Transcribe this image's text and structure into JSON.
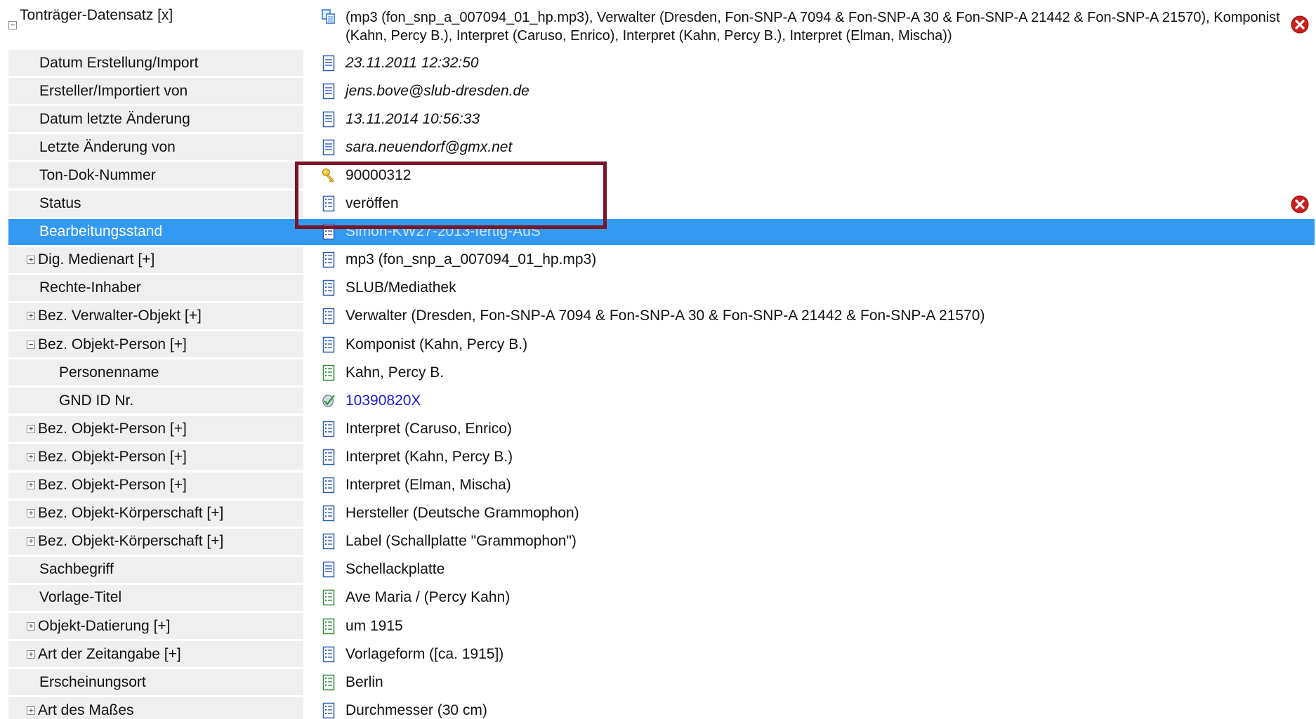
{
  "header": {
    "label": "Tonträger-Datensatz [x]",
    "value": "(mp3 (fon_snp_a_007094_01_hp.mp3), Verwalter (Dresden, Fon-SNP-A 7094 & Fon-SNP-A 30 & Fon-SNP-A 21442 & Fon-SNP-A 21570), Komponist (Kahn, Percy B.), Interpret (Caruso, Enrico), Interpret (Kahn, Percy B.), Interpret (Elman, Mischa))",
    "icon": "copy-records-icon",
    "expander": "−"
  },
  "rows": [
    {
      "label": "Datum Erstellung/Import",
      "value": "23.11.2011 12:32:50",
      "icon": "document-icon"
    },
    {
      "label": "Ersteller/Importiert von",
      "value": "jens.bove@slub-dresden.de",
      "icon": "document-icon"
    },
    {
      "label": "Datum letzte Änderung",
      "value": "13.11.2014 10:56:33",
      "icon": "document-icon"
    },
    {
      "label": "Letzte Änderung von",
      "value": "sara.neuendorf@gmx.net",
      "icon": "document-icon"
    },
    {
      "label": "Ton-Dok-Nummer",
      "value": "90000312",
      "icon": "key-icon"
    },
    {
      "label": "Status",
      "value": "veröffen",
      "icon": "list-icon"
    },
    {
      "label": "Bearbeitungsstand",
      "value": "Simon-KW27-2013-fertig-AuS",
      "icon": "list-icon"
    },
    {
      "label": "Dig. Medienart [+]",
      "value": "mp3 (fon_snp_a_007094_01_hp.mp3)",
      "icon": "list-icon",
      "expander": "+"
    },
    {
      "label": "Rechte-Inhaber",
      "value": "SLUB/Mediathek",
      "icon": "list-icon"
    },
    {
      "label": "Bez. Verwalter-Objekt [+]",
      "value": "Verwalter (Dresden, Fon-SNP-A 7094 & Fon-SNP-A 30 & Fon-SNP-A 21442 & Fon-SNP-A 21570)",
      "icon": "list-icon",
      "expander": "+"
    },
    {
      "label": "Bez. Objekt-Person [+]",
      "value": "Komponist (Kahn, Percy B.)",
      "icon": "list-icon",
      "expander": "−"
    },
    {
      "label": "Personenname",
      "value": "Kahn, Percy B.",
      "icon": "green-list-icon"
    },
    {
      "label": "GND ID Nr.",
      "value": "10390820X",
      "icon": "link-check-icon"
    },
    {
      "label": "Bez. Objekt-Person [+]",
      "value": "Interpret (Caruso, Enrico)",
      "icon": "list-icon",
      "expander": "+"
    },
    {
      "label": "Bez. Objekt-Person [+]",
      "value": "Interpret (Kahn, Percy B.)",
      "icon": "list-icon",
      "expander": "+"
    },
    {
      "label": "Bez. Objekt-Person [+]",
      "value": "Interpret (Elman, Mischa)",
      "icon": "list-icon",
      "expander": "+"
    },
    {
      "label": "Bez. Objekt-Körperschaft [+]",
      "value": "Hersteller (Deutsche Grammophon)",
      "icon": "list-icon",
      "expander": "+"
    },
    {
      "label": "Bez. Objekt-Körperschaft [+]",
      "value": "Label (Schallplatte \"Grammophon\")",
      "icon": "list-icon",
      "expander": "+"
    },
    {
      "label": "Sachbegriff",
      "value": "Schellackplatte",
      "icon": "document-icon"
    },
    {
      "label": "Vorlage-Titel",
      "value": "Ave Maria / (Percy Kahn)",
      "icon": "green-list-icon"
    },
    {
      "label": "Objekt-Datierung [+]",
      "value": "um 1915",
      "icon": "green-list-icon",
      "expander": "+"
    },
    {
      "label": "Art der Zeitangabe [+]",
      "value": "Vorlageform ([ca. 1915])",
      "icon": "list-icon",
      "expander": "+"
    },
    {
      "label": "Erscheinungsort",
      "value": "Berlin",
      "icon": "green-list-icon"
    },
    {
      "label": "Art des Maßes",
      "value": "Durchmesser (30 cm)",
      "icon": "list-icon",
      "expander": "+"
    }
  ],
  "colors": {
    "selection": "#3399f3",
    "highlight_border": "#7a1428",
    "error": "#cc1f1f",
    "label_bg": "#efefef",
    "link": "#1a1adb"
  }
}
